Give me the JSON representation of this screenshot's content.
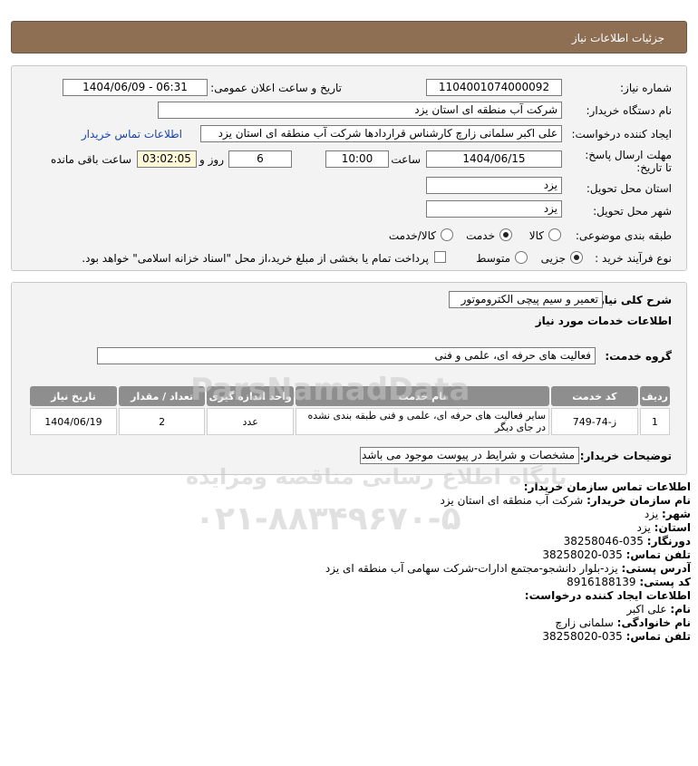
{
  "header": {
    "title": "جزئیات اطلاعات نیاز"
  },
  "details": {
    "need_number_label": "شماره نیاز:",
    "need_number": "1104001074000092",
    "announce_label": "تاریخ و ساعت اعلان عمومی:",
    "announce_value": "1404/06/09 - 06:31",
    "buyer_org_label": "نام دستگاه خریدار:",
    "buyer_org": "شرکت آب منطقه ای استان یزد",
    "creator_label": "ایجاد کننده درخواست:",
    "creator": "علی اکبر سلمانی زارچ کارشناس قراردادها شرکت آب منطقه ای استان یزد",
    "contact_link": "اطلاعات تماس خریدار",
    "deadline_label": "مهلت ارسال پاسخ: تا تاریخ:",
    "deadline_date": "1404/06/15",
    "time_label": "ساعت",
    "deadline_time": "10:00",
    "days": "6",
    "days_label": "روز و",
    "remaining": "03:02:05",
    "remaining_label": "ساعت باقی مانده",
    "province_label": "استان محل تحویل:",
    "province": "یزد",
    "city_label": "شهر محل تحویل:",
    "city": "یزد",
    "category_label": "طبقه بندی موضوعی:",
    "category_options": [
      "کالا",
      "خدمت",
      "کالا/خدمت"
    ],
    "process_label": "نوع فرآیند خرید :",
    "process_options": [
      "جزیی",
      "متوسط"
    ],
    "payment_note": "پرداخت تمام یا بخشی از مبلغ خرید،از محل \"اسناد خزانه اسلامی\" خواهد بود."
  },
  "summary": {
    "desc_label": "شرح کلی نیاز:",
    "desc": "تعمیر و سیم پیچی الکتروموتور",
    "services_title": "اطلاعات خدمات مورد نیاز",
    "group_label": "گروه خدمت:",
    "group": "فعالیت های حرفه ای، علمی و فنی",
    "table": {
      "headers": [
        "ردیف",
        "کد خدمت",
        "نام خدمت",
        "واحد اندازه گیری",
        "تعداد / مقدار",
        "تاریخ نیاز"
      ],
      "rows": [
        [
          "1",
          "ز-74-749",
          "سایر فعالیت های حرفه ای، علمی و فنی طبقه بندی نشده در جای دیگر",
          "عدد",
          "2",
          "1404/06/19"
        ]
      ]
    },
    "buyer_notes_label": "توضیحات خریدار:",
    "buyer_notes": "مشخصات و شرایط در پیوست موجود می باشد."
  },
  "contact": {
    "title": "اطلاعات تماس سازمان خریدار:",
    "org_label": "نام سازمان خریدار:",
    "org": "شرکت آب منطقه ای استان یزد",
    "city_label": "شهر:",
    "city": "یزد",
    "province_label": "استان:",
    "province": "یزد",
    "fax_label": "دورنگار:",
    "fax": "035-38258046",
    "phone_label": "تلفن تماس:",
    "phone": "035-38258020",
    "address_label": "آدرس پستی:",
    "address": "یزد-بلوار دانشجو-مجتمع ادارات-شرکت سهامی آب منطقه ای یزد",
    "postal_label": "کد پستی:",
    "postal": "8916188139",
    "creator_title": "اطلاعات ایجاد کننده درخواست:",
    "first_label": "نام:",
    "first": "علی اکبر",
    "last_label": "نام خانوادگی:",
    "last": "سلمانی زارچ",
    "creator_phone_label": "تلفن تماس:",
    "creator_phone": "035-38258020"
  },
  "watermark": {
    "line1": "ParsNamadData",
    "line2": "پایگاه اطلاع رسانی مناقصه ومزایده",
    "line3": "۰۲۱-۸۸۳۴۹۶۷۰-۵"
  }
}
